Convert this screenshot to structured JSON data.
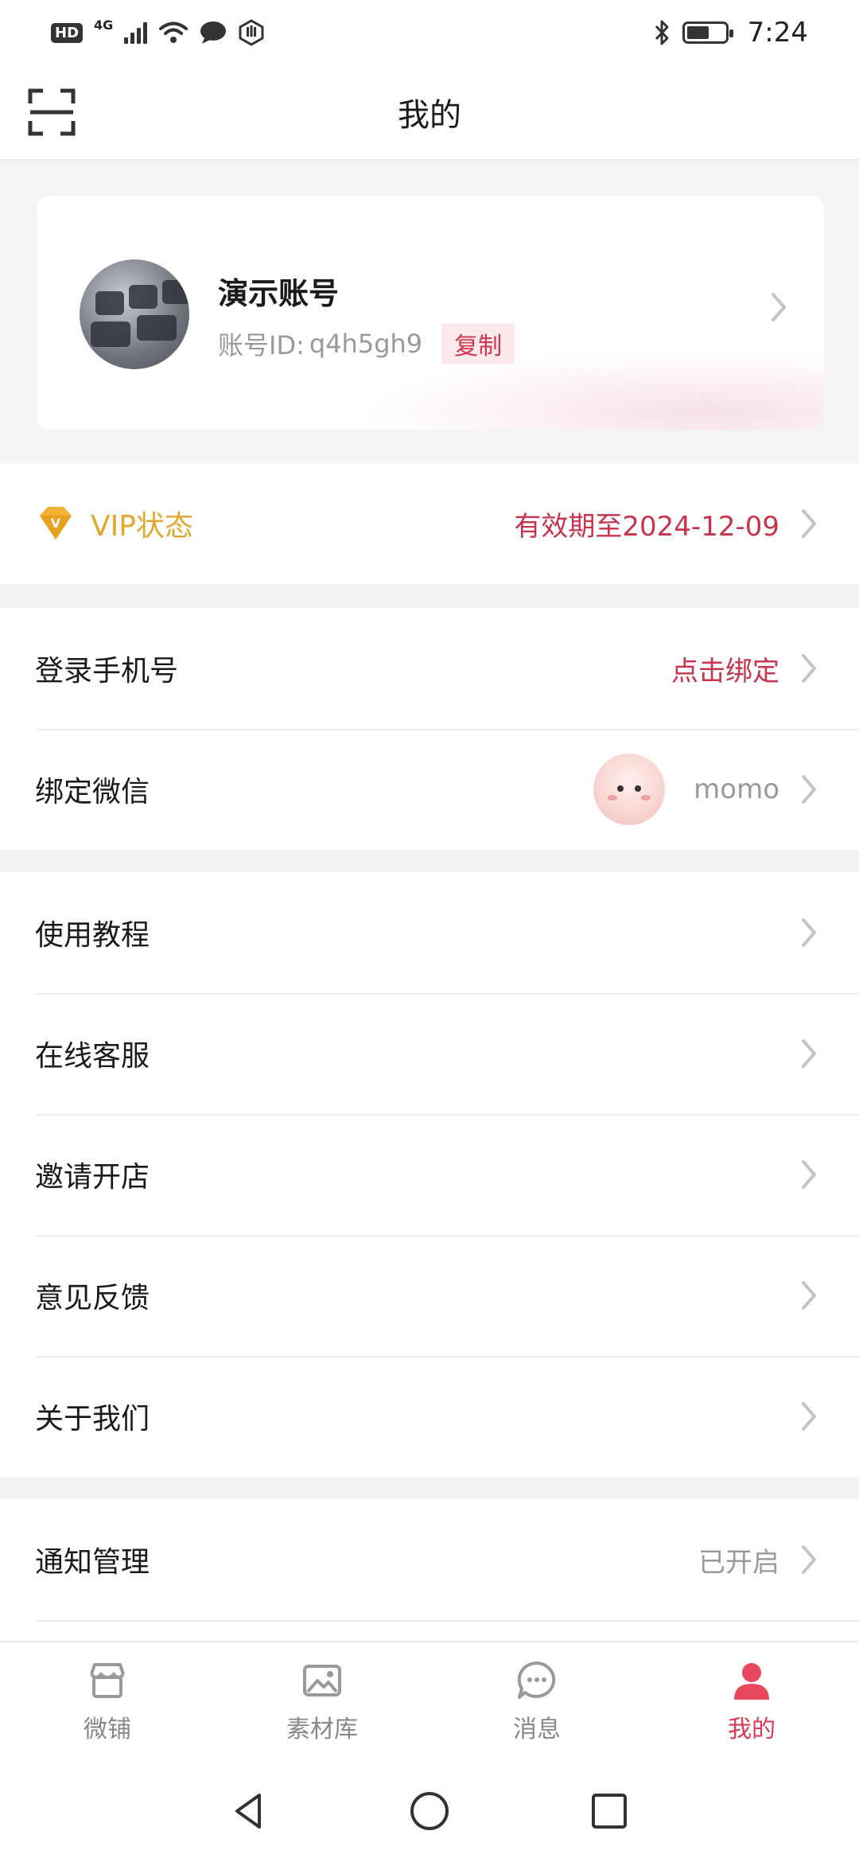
{
  "status_bar": {
    "hd": "HD",
    "network": "4G",
    "time": "7:24"
  },
  "header": {
    "title": "我的"
  },
  "profile": {
    "name": "演示账号",
    "account_prefix": "账号ID:",
    "account_id": "q4h5gh9",
    "copy_label": "复制"
  },
  "vip": {
    "label": "VIP状态",
    "value": "有效期至2024-12-09",
    "badge_letter": "V"
  },
  "bindings": [
    {
      "label": "登录手机号",
      "value": "点击绑定"
    },
    {
      "label": "绑定微信",
      "value": "momo"
    }
  ],
  "menu": [
    {
      "label": "使用教程"
    },
    {
      "label": "在线客服"
    },
    {
      "label": "邀请开店"
    },
    {
      "label": "意见反馈"
    },
    {
      "label": "关于我们"
    }
  ],
  "notifications": {
    "label": "通知管理",
    "value": "已开启"
  },
  "bottom_nav": [
    {
      "label": "微铺",
      "icon": "store-icon"
    },
    {
      "label": "素材库",
      "icon": "image-library-icon"
    },
    {
      "label": "消息",
      "icon": "message-icon"
    },
    {
      "label": "我的",
      "icon": "profile-icon",
      "active": true
    }
  ],
  "colors": {
    "accent": "#d93b52",
    "vip_gold": "#e2a72e",
    "muted": "#999999"
  }
}
